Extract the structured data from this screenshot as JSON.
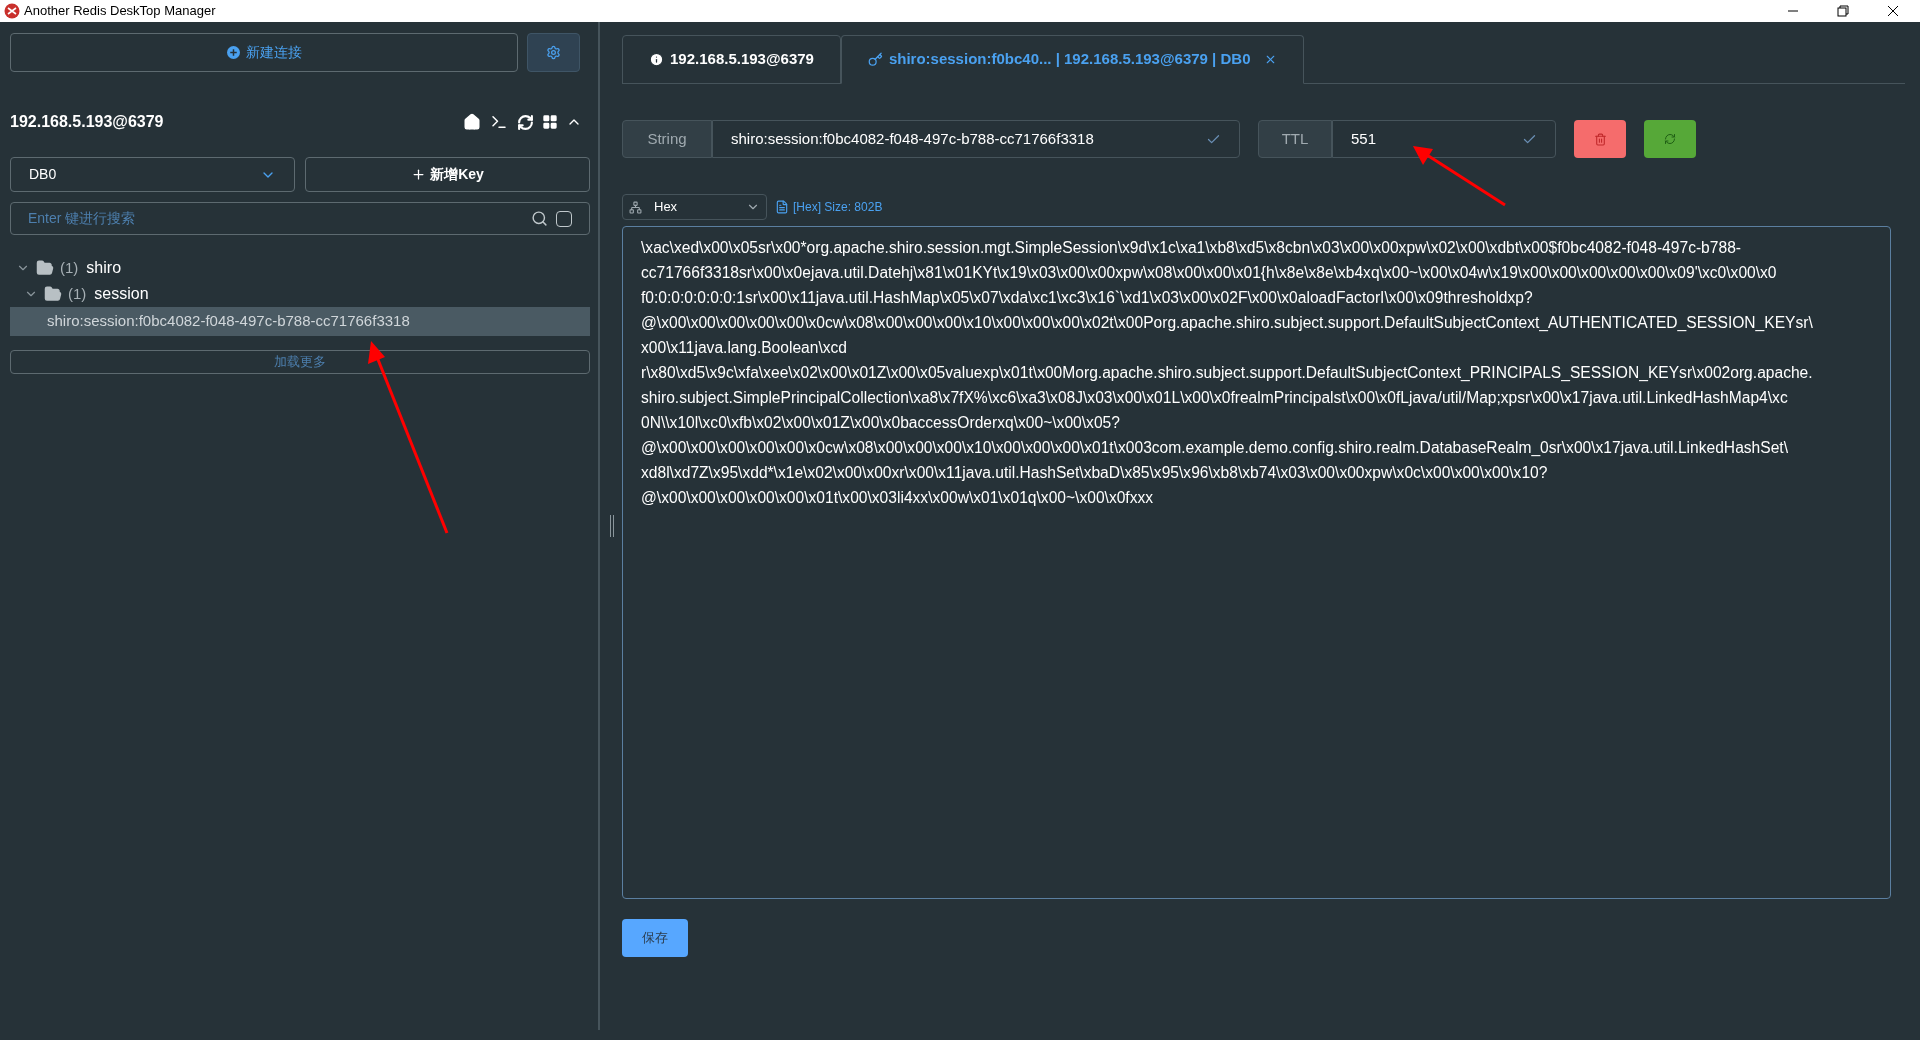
{
  "window": {
    "title": "Another Redis DeskTop Manager"
  },
  "sidebar": {
    "new_connection_button": "新建连接",
    "connection": {
      "name": "192.168.5.193@6379",
      "expanded": true
    },
    "db_select": "DB0",
    "new_key_button": "新增Key",
    "search": {
      "placeholder": "Enter 键进行搜索",
      "checked": false
    },
    "tree": [
      {
        "count": "(1)",
        "label": "shiro",
        "expanded": true,
        "children": [
          {
            "count": "(1)",
            "label": "session",
            "expanded": true,
            "children": [
              {
                "label": "shiro:session:f0bc4082-f048-497c-b788-cc71766f3318",
                "selected": true
              }
            ]
          }
        ]
      }
    ],
    "load_more_button": "加载更多"
  },
  "tabs": [
    {
      "kind": "info",
      "label": "192.168.5.193@6379",
      "selected": false,
      "closable": false
    },
    {
      "kind": "key",
      "label": "shiro:session:f0bc40... | 192.168.5.193@6379 | DB0",
      "selected": true,
      "closable": true
    }
  ],
  "key_panel": {
    "type": "String",
    "key": "shiro:session:f0bc4082-f048-497c-b788-cc71766f3318",
    "ttl_label": "TTL",
    "ttl": "551",
    "format": "Hex",
    "size_info": "[Hex] Size: 802B",
    "value_lines": [
      "\\xac\\xed\\x00\\x05sr\\x00*org.apache.shiro.session.mgt.SimpleSession\\x9d\\x1c\\xa1\\xb8\\xd5\\x8cbn\\x03\\x00\\x00xpw\\x02\\x00\\xdbt\\x00$f0bc4082-f048-497c-b788-",
      "cc71766f3318sr\\x00\\x0ejava.util.Datehj\\x81\\x01KYt\\x19\\x03\\x00\\x00xpw\\x08\\x00\\x00\\x01{h\\x8e\\x8e\\xb4xq\\x00~\\x00\\x04w\\x19\\x00\\x00\\x00\\x00\\x00\\x09'\\xc0\\x00\\x0",
      "f0:0:0:0:0:0:0:1sr\\x00\\x11java.util.HashMap\\x05\\x07\\xda\\xc1\\xc3\\x16`\\xd1\\x03\\x00\\x02F\\x00\\x0aloadFactorI\\x00\\x09thresholdxp?",
      "@\\x00\\x00\\x00\\x00\\x00\\x0cw\\x08\\x00\\x00\\x00\\x10\\x00\\x00\\x00\\x02t\\x00Porg.apache.shiro.subject.support.DefaultSubjectContext_AUTHENTICATED_SESSION_KEYsr\\",
      "x00\\x11java.lang.Boolean\\xcd",
      "r\\x80\\xd5\\x9c\\xfa\\xee\\x02\\x00\\x01Z\\x00\\x05valuexp\\x01t\\x00Morg.apache.shiro.subject.support.DefaultSubjectContext_PRINCIPALS_SESSION_KEYsr\\x002org.apache.",
      "shiro.subject.SimplePrincipalCollection\\xa8\\x7fX%\\xc6\\xa3\\x08J\\x03\\x00\\x01L\\x00\\x0frealmPrincipalst\\x00\\x0fLjava/util/Map;xpsr\\x00\\x17java.util.LinkedHashMap4\\xc",
      "0N\\\\x10l\\xc0\\xfb\\x02\\x00\\x01Z\\x00\\x0baccessOrderxq\\x00~\\x00\\x05?",
      "@\\x00\\x00\\x00\\x00\\x00\\x0cw\\x08\\x00\\x00\\x00\\x10\\x00\\x00\\x00\\x01t\\x003com.example.demo.config.shiro.realm.DatabaseRealm_0sr\\x00\\x17java.util.LinkedHashSet\\",
      "xd8l\\xd7Z\\x95\\xdd*\\x1e\\x02\\x00\\x00xr\\x00\\x11java.util.HashSet\\xbaD\\x85\\x95\\x96\\xb8\\xb74\\x03\\x00\\x00xpw\\x0c\\x00\\x00\\x00\\x10?",
      "@\\x00\\x00\\x00\\x00\\x00\\x01t\\x00\\x03li4xx\\x00w\\x01\\x01q\\x00~\\x00\\x0fxxx"
    ],
    "save_button": "保存"
  }
}
